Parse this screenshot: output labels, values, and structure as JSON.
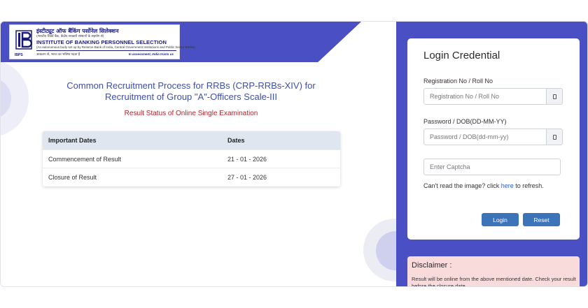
{
  "header": {
    "logo_hindi": "इंस्टीट्यूट ऑफ बैंकिंग पर्सोनेल सिलेक्शन",
    "logo_hindi_sub": "(भारतीय रिज़र्व बैंक, केंद्रीय सरकारी संस्थानों के सहयोग से)",
    "logo_english": "INSTITUTE OF BANKING PERSONNEL SELECTION",
    "logo_english_sub": "(An autonomous body set up by Reserve Bank of India, Central Government Institutions and Public Sector Banks)",
    "logo_tagline_hindi": "आकलन से, भारत का भविष्य गढ़ता है",
    "logo_tagline_english": "In assessment, India trusts us",
    "logo_abbr": "IBPS"
  },
  "main": {
    "title": "Common Recruitment Process for RRBs (CRP-RRBs-XIV) for Recruitment of Group \"A\"-Officers Scale-III",
    "subtitle": "Result Status of Online Single Examination",
    "table": {
      "headers": [
        "Important Dates",
        "Dates"
      ],
      "rows": [
        [
          "Commencement of Result",
          "21 - 01 - 2026"
        ],
        [
          "Closure of Result",
          "27 - 01 - 2026"
        ]
      ]
    }
  },
  "login": {
    "title": "Login Credential",
    "reg_label": "Registration No / Roll No",
    "reg_placeholder": "Registration No / Roll No",
    "pwd_label": "Password / DOB(DD-MM-YY)",
    "pwd_placeholder": "Password / DOB(dd-mm-yy)",
    "captcha_placeholder": "Enter Captcha",
    "refresh_prefix": "Can't read the image? click ",
    "refresh_link": "here",
    "refresh_suffix": " to refresh.",
    "login_button": "Login",
    "reset_button": "Reset"
  },
  "disclaimer": {
    "title": "Disclaimer :",
    "text": "Result will be online from the above mentioned date. Check your result before the closure date."
  },
  "colors": {
    "accent": "#4a4fc4",
    "button": "#3d74b9",
    "title_text": "#3f4fa6",
    "subtitle_text": "#b8202a",
    "disclaimer_bg": "#fadbdb"
  }
}
